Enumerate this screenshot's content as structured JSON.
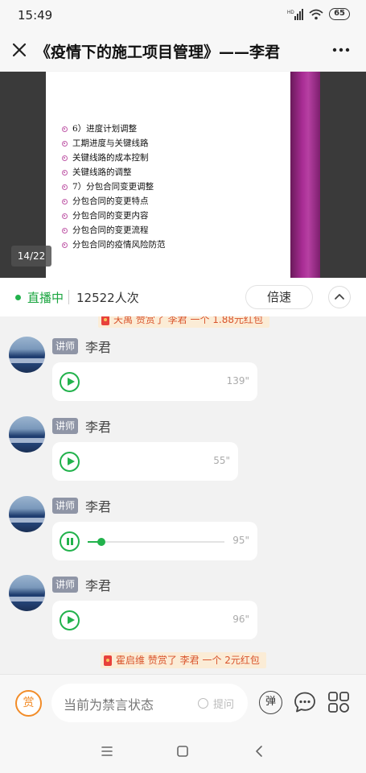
{
  "status_bar": {
    "time": "15:49",
    "battery": "65",
    "network": "HD"
  },
  "header": {
    "title": "《疫情下的施工项目管理》——李君",
    "close_icon": "close-icon",
    "more_icon": "more-dots-icon"
  },
  "slide": {
    "items": [
      "6）进度计划调整",
      "工期进度与关键线路",
      "关键线路的成本控制",
      "关键线路的调整",
      "7）分包合同变更调整",
      "分包合同的变更特点",
      "分包合同的变更内容",
      "分包合同的变更流程",
      "分包合同的疫情风险防范"
    ],
    "page": "14/22",
    "accent_color": "#b640a2"
  },
  "live_bar": {
    "status": "直播中",
    "viewers": "12522人次",
    "speed_label": "倍速",
    "collapse_icon": "chevron-up-icon",
    "status_color": "#1aa53f"
  },
  "chat": {
    "top_notice": "天禹 赞赏了 李君 一个 1.88元红包",
    "messages": [
      {
        "role": "讲师",
        "sender": "李君",
        "duration": "139\"",
        "state": "stopped"
      },
      {
        "role": "讲师",
        "sender": "李君",
        "duration": "55\"",
        "state": "stopped"
      },
      {
        "role": "讲师",
        "sender": "李君",
        "duration": "95\"",
        "state": "playing",
        "progress": 0.1
      },
      {
        "role": "讲师",
        "sender": "李君",
        "duration": "96\"",
        "state": "stopped"
      }
    ],
    "bottom_notice": "霍启维 赞赏了 李君 一个 2元红包"
  },
  "input_bar": {
    "reward_label": "赏",
    "placeholder": "当前为禁言状态",
    "ask_label": "提问",
    "danmu_label": "弹",
    "chat_icon": "chat-bubble-icon",
    "grid_icon": "grid-menu-icon"
  },
  "nav_bar": {
    "icons": [
      "menu-icon",
      "home-square-icon",
      "back-icon"
    ]
  }
}
